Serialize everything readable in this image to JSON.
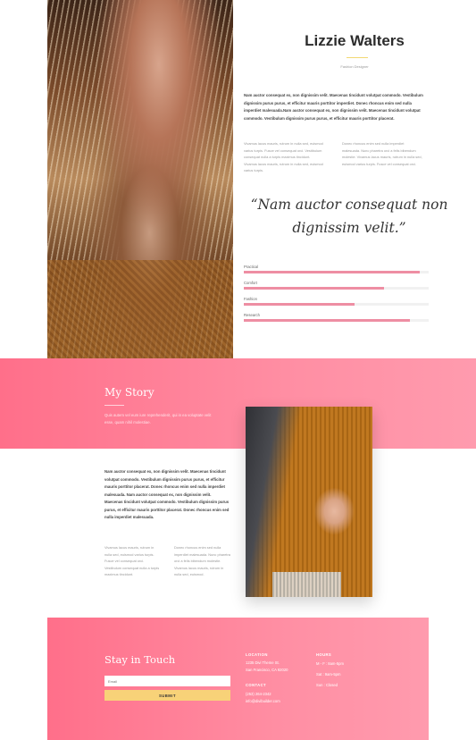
{
  "profile": {
    "name": "Lizzie Walters",
    "role": "Fashion Designer",
    "intro": "Nam auctor consequat ex, non dignissim velit. Maecenas tincidunt volutpat commodo. Vestibulum dignissim purus purus, et efficitur mauris porttitor imperdiet. Donec rhoncus enim sed nulla imperdiet malesuada.Nam auctor consequat ex, non dignissim velit. Maecenas tincidunt volutpat commodo. Vestibulum dignissim purus purus, et efficitur mauris porttitor placerat.",
    "col_left": "Vivamus lacus mauris, rutrum in nulla sed, euismod varius turpis. Fusce vel consequat orci. Vestibulum consequat nulla a turpis maximus tincidunt. Vivamus lacus mauris, rutrum in nulla sed, euismod varius turpis.",
    "col_right": "Donec rhoncus enim sed nulla imperdiet malesuada. Nunc pharetra orci a felis bibendum molestie. Vivamus lacus mauris, rutrum in nulla sed, euismod varius turpis. Fusce vel consequat orci.",
    "quote": "“Nam auctor consequat non dignissim velit.”"
  },
  "skills": [
    {
      "label": "Practical",
      "level": 0.95
    },
    {
      "label": "Comfort",
      "level": 0.76
    },
    {
      "label": "Fashion",
      "level": 0.6
    },
    {
      "label": "Research",
      "level": 0.9
    }
  ],
  "story": {
    "title": "My Story",
    "subtitle": "Quis autem vel eum iure reprehenderit, qui in ea voluptate velit esse, quam nihil molestiae.",
    "body": "Nam auctor consequat ex, non dignissim velit. Maecenas tincidunt volutpat commodo. Vestibulum dignissim purus purus, et efficitur mauris porttitor placerat. Donec rhoncus enim sed nulla imperdiet malesuada. Nam auctor consequat ex, non dignissim velit. Maecenas tincidunt volutpat commodo. Vestibulum dignissim purus purus, et efficitur mauris porttitor placerat. Donec rhoncus enim sed nulla imperdiet malesuada.",
    "col_left": "Vivamus lacus mauris, rutrum in nulla sed, euismod varius turpis. Fusce vel consequat orci. Vestibulum consequat nulla a turpis maximus tincidunt.",
    "col_right": "Donec rhoncus enim sed nulla imperdiet malesuada. Nunc pharetra orci a felis bibendum molestie. Vivamus lacus mauris, rutrum in nulla sed, euismod."
  },
  "contact": {
    "title": "Stay in Touch",
    "email_placeholder": "Email",
    "submit_label": "SUBMIT",
    "location_head": "LOCATION",
    "location_lines": [
      "1235 Divi Theme St.",
      "San Francisco, CA 92020"
    ],
    "contact_head": "CONTACT",
    "contact_lines": [
      "(253) 264-2342",
      "info@divibuilder.com"
    ],
    "hours_head": "HOURS",
    "hours_lines": [
      "M - F : 8am-5pm",
      "Sat : 9am-5pm",
      "Sun : Closed"
    ]
  },
  "colors": {
    "accent_pink": "#ff7f97",
    "accent_yellow": "#f8d278",
    "skill_fill": "#ee8ea3"
  }
}
